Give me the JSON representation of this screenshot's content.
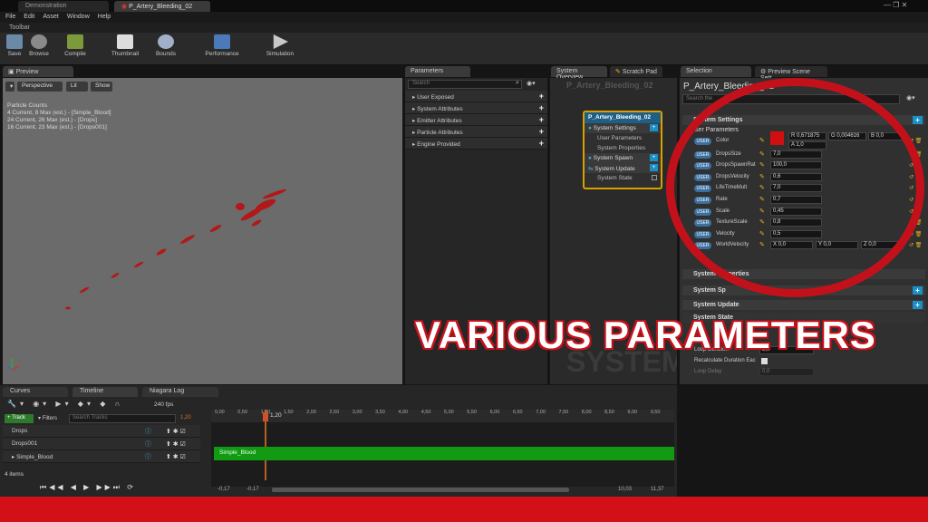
{
  "tabs": [
    "Demonstration",
    "P_Artery_Bleeding_02"
  ],
  "menu": [
    "File",
    "Edit",
    "Asset",
    "Window",
    "Help"
  ],
  "toolbar_header": "Toolbar",
  "toolbar": [
    "Save",
    "Browse",
    "Compile",
    "Thumbnail",
    "Bounds",
    "Performance",
    "Simulation"
  ],
  "preview": {
    "tab": "Preview",
    "perspective": "Perspective",
    "lit": "Lit",
    "show": "Show",
    "stats": [
      "Particle Counts",
      "4 Current, 8 Max (est.) - [Simple_Blood]",
      "24 Current, 26 Max (est.) - [Drops]",
      "16 Current, 23 Max (est.) - [Drops001]"
    ]
  },
  "parameters": {
    "tab": "Parameters",
    "search": "Search",
    "groups": [
      "User Exposed",
      "System Attributes",
      "Emitter Attributes",
      "Particle Attributes",
      "Engine Provided"
    ]
  },
  "overview": {
    "tab1": "System Overview",
    "tab2": "Scratch Pad",
    "title": "P_Artery_Bleeding_02",
    "node_title": "P_Artery_Bleeding_02",
    "rows": [
      "System Settings",
      "User Parameters",
      "System Properties",
      "System Spawn",
      "System Update",
      "System State"
    ],
    "watermark": "SYSTEM"
  },
  "selection": {
    "tab1": "Selection",
    "tab2": "Preview Scene Sett",
    "title": "P_Artery_Bleeding_02",
    "search": "Search the",
    "system_settings": "System Settings",
    "user_params": "User Parameters",
    "user_tag": "USER",
    "params": [
      {
        "name": "Color",
        "value": ""
      },
      {
        "name": "DropsSize",
        "value": "7,0"
      },
      {
        "name": "DropsSpawnRat",
        "value": "100,0"
      },
      {
        "name": "DropsVelocity",
        "value": "0,6"
      },
      {
        "name": "LifeTimeMult",
        "value": "7,0"
      },
      {
        "name": "Rate",
        "value": "0,7"
      },
      {
        "name": "Scale",
        "value": "0,45"
      },
      {
        "name": "TextureScale",
        "value": "0,8"
      },
      {
        "name": "Velocity",
        "value": "0,5"
      },
      {
        "name": "WorldVelocity",
        "value": ""
      }
    ],
    "color_r": "R 0,671875",
    "color_g": "G 0,004616",
    "color_b": "B 0,0",
    "color_a": "A 1,0",
    "color_swatch": "#d01010",
    "wv_x": "X 0,0",
    "wv_y": "Y 0,0",
    "wv_z": "Z 0,0",
    "system_properties": "System Properties",
    "system_spawn": "System Sp",
    "system_update": "System Update",
    "system_state": "System State",
    "loop_duration": "Loop Duration",
    "loop_duration_val": "5,0",
    "recalc": "Recalculate Duration Eac",
    "loop_delay": "Loop Delay",
    "loop_delay_val": "0,0"
  },
  "bottom": {
    "tabs": [
      "Curves",
      "Timeline",
      "Niagara Log"
    ],
    "fps": "240 fps",
    "track_btn": "Track",
    "filters": "Filters",
    "search": "Search Tracks",
    "tracks": [
      "Drops",
      "Drops001",
      "Simple_Blood"
    ],
    "items": "4 items",
    "playhead": "1,20",
    "current": "1,20",
    "bar_label": "Simple_Blood",
    "ticks": [
      "0,00",
      "0,50",
      "1,00",
      "1,50",
      "2,00",
      "2,50",
      "3,00",
      "3,50",
      "4,00",
      "4,50",
      "5,00",
      "5,50",
      "6,00",
      "6,50",
      "7,00",
      "7,50",
      "8,00",
      "8,50",
      "9,00",
      "9,50"
    ],
    "range_start": "-0,17",
    "range_start2": "-0,17",
    "range_end": "10,03",
    "range_end2": "11,37"
  },
  "overlay": "VARIOUS PARAMETERS"
}
